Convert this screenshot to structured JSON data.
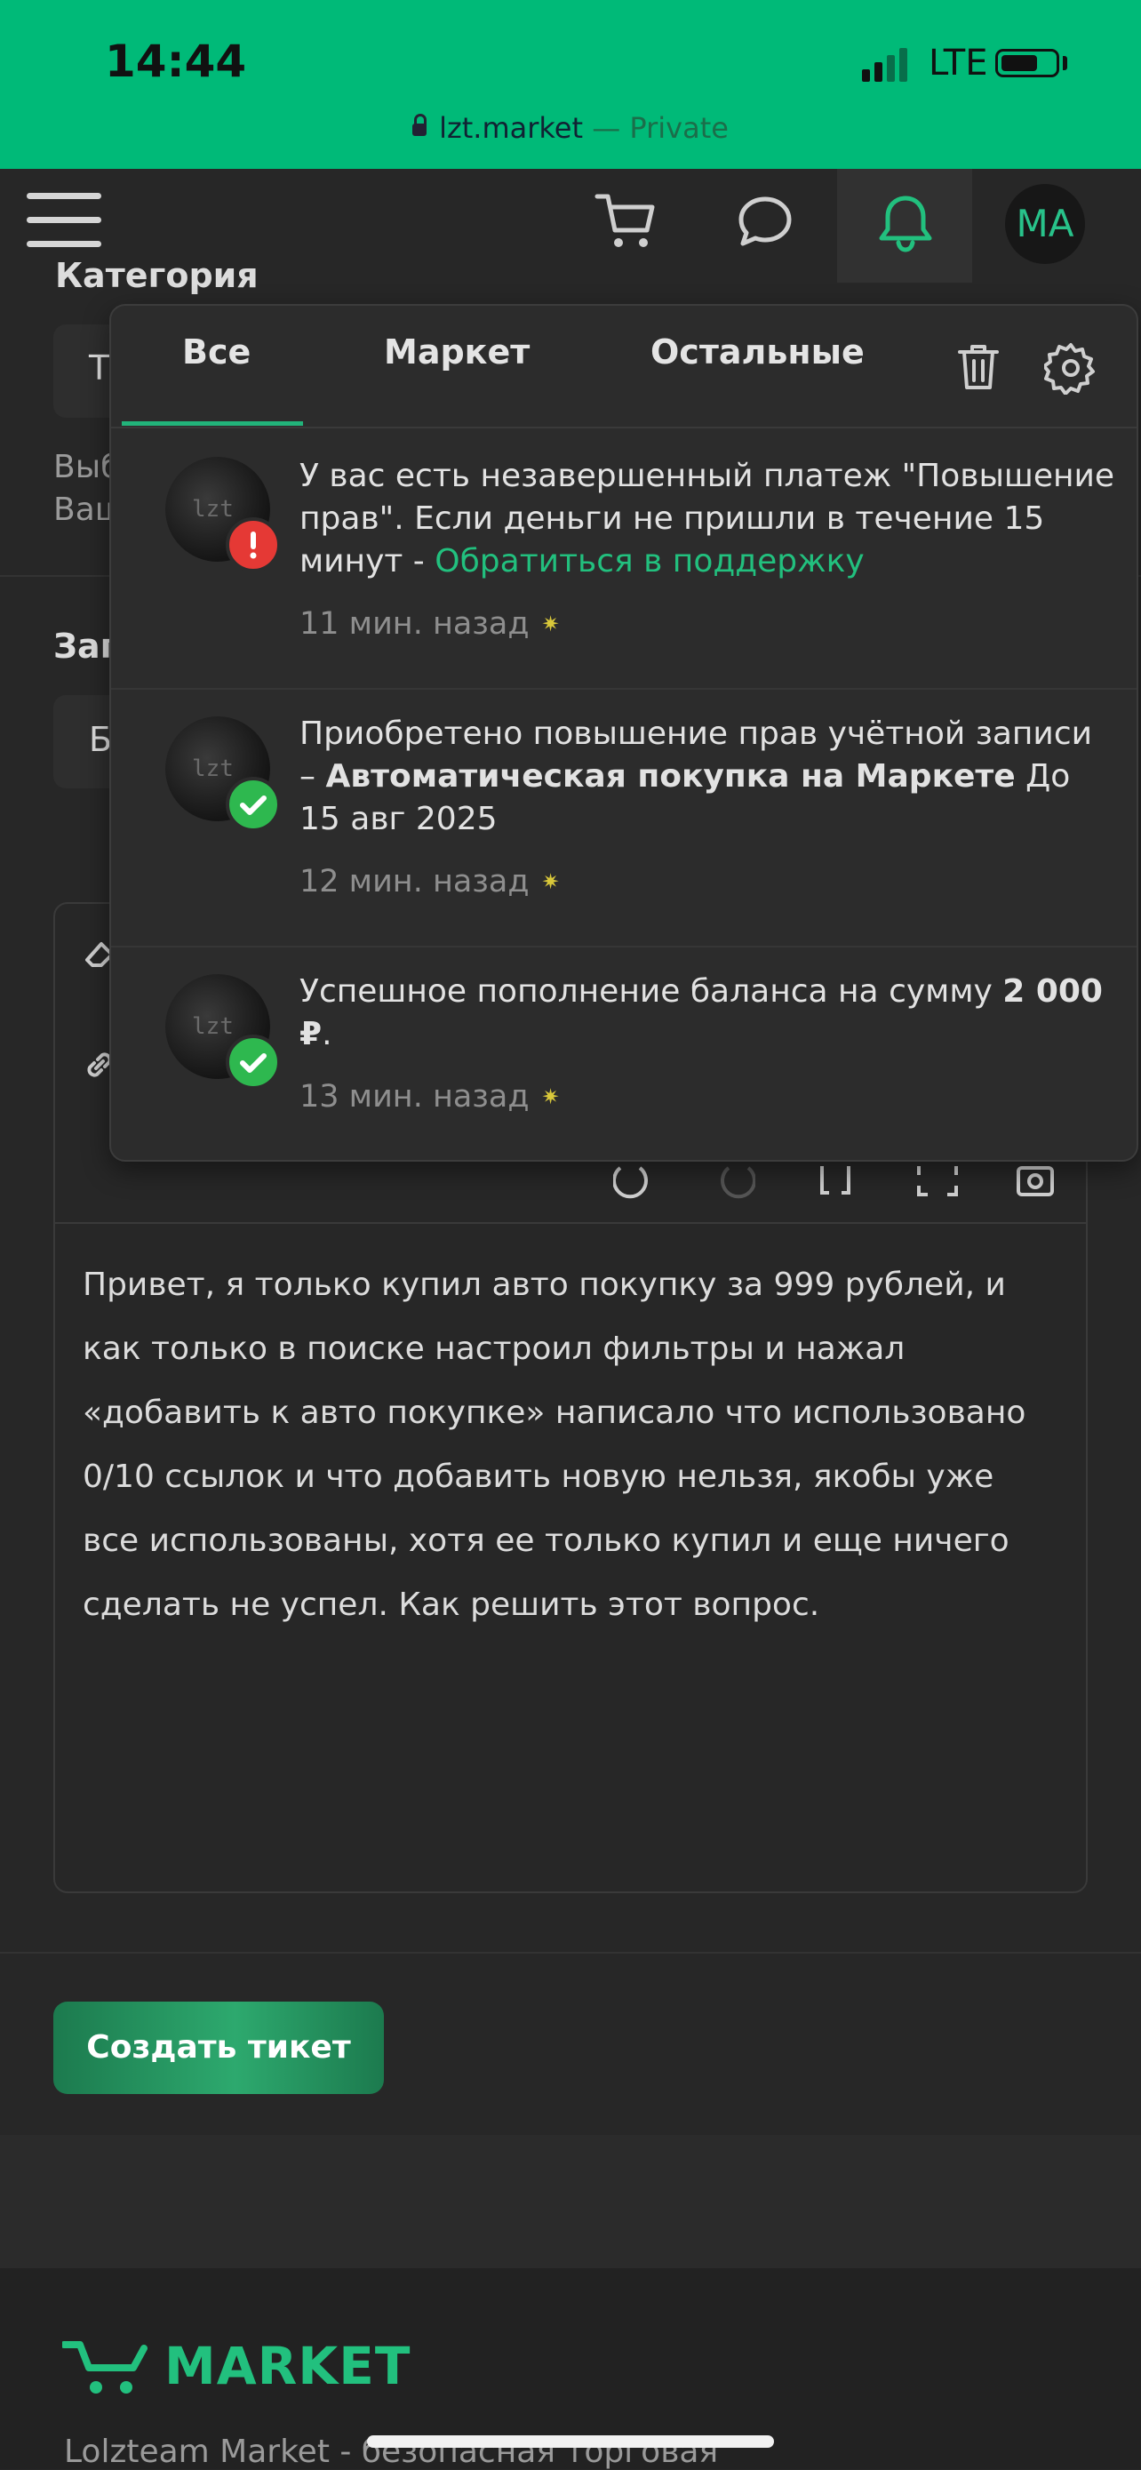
{
  "status_bar": {
    "time": "14:44",
    "network": "LTE",
    "url": "lzt.market",
    "url_suffix": " — Private"
  },
  "header": {
    "avatar_initials": "MA",
    "icons": [
      "menu-icon",
      "cart-icon",
      "chat-icon",
      "bell-icon"
    ]
  },
  "background_form": {
    "category_label": "Категория",
    "category_value": "Т",
    "hint_line1": "Выб",
    "hint_line2": "Ваш",
    "title_label": "Заг",
    "title_value": "Б",
    "message": "Привет, я только купил авто покупку за 999 рублей, и как только в поиске настроил фильтры и нажал «добавить к авто покупке» написало что использовано 0/10 ссылок и что добавить новую нельзя, якобы уже все использованы, хотя ее только купил и еще ничего сделать не успел. Как решить этот вопрос.",
    "submit_label": "Создать тикет"
  },
  "notifications_panel": {
    "tabs": [
      {
        "label": "Все",
        "active": true
      },
      {
        "label": "Маркет",
        "active": false
      },
      {
        "label": "Остальные",
        "active": false
      }
    ],
    "items": [
      {
        "status": "error",
        "text": "У вас есть незавершенный платеж \"Повышение прав\". Если деньги не пришли в течение 15 минут - ",
        "link": "Обратиться в поддержку",
        "time": "11 мин. назад"
      },
      {
        "status": "success",
        "text_before": "Приобретено повышение прав учётной записи – ",
        "text_bold": "Автоматическая покупка на Маркете",
        "text_after": " До 15 авг 2025",
        "time": "12 мин. назад"
      },
      {
        "status": "success",
        "text_before": "Успешное пополнение баланса на сумму ",
        "text_bold": "2 000 ₽",
        "text_after": ".",
        "time": "13 мин. назад"
      }
    ]
  },
  "footer": {
    "logo": "MARKET",
    "description": "Lolzteam Market - безопасная торговая"
  },
  "colors": {
    "accent": "#00ba78",
    "link": "#22c07e",
    "error": "#e53935",
    "success": "#2eb84f"
  }
}
